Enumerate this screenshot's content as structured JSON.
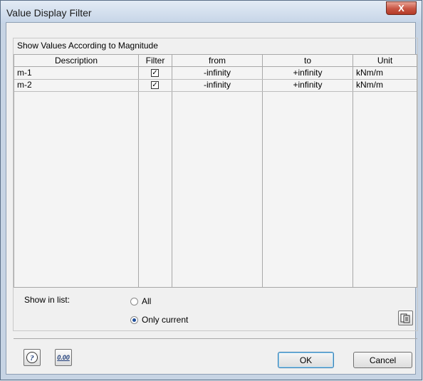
{
  "window": {
    "title": "Value Display Filter",
    "close_glyph": "X"
  },
  "group": {
    "title": "Show Values According to Magnitude"
  },
  "table": {
    "headers": {
      "description": "Description",
      "filter": "Filter",
      "from": "from",
      "to": "to",
      "unit": "Unit"
    },
    "rows": [
      {
        "description": "m-1",
        "filter": true,
        "from": "-infinity",
        "to": "+infinity",
        "unit": "kNm/m"
      },
      {
        "description": "m-2",
        "filter": true,
        "from": "-infinity",
        "to": "+infinity",
        "unit": "kNm/m"
      }
    ]
  },
  "show_in_list": {
    "label": "Show in list:",
    "options": [
      {
        "label": "All",
        "selected": false
      },
      {
        "label": "Only current",
        "selected": true
      }
    ]
  },
  "footer": {
    "ok_label": "OK",
    "cancel_label": "Cancel",
    "decimals_icon_text": "0.00"
  },
  "icons": [
    "close-icon",
    "checkbox-checked-icon",
    "help-icon",
    "decimals-icon",
    "export-icon"
  ],
  "colors": {
    "titlebar": "#c5d4e7",
    "close_button": "#c75442",
    "default_button_border": "#3c7fb1"
  }
}
